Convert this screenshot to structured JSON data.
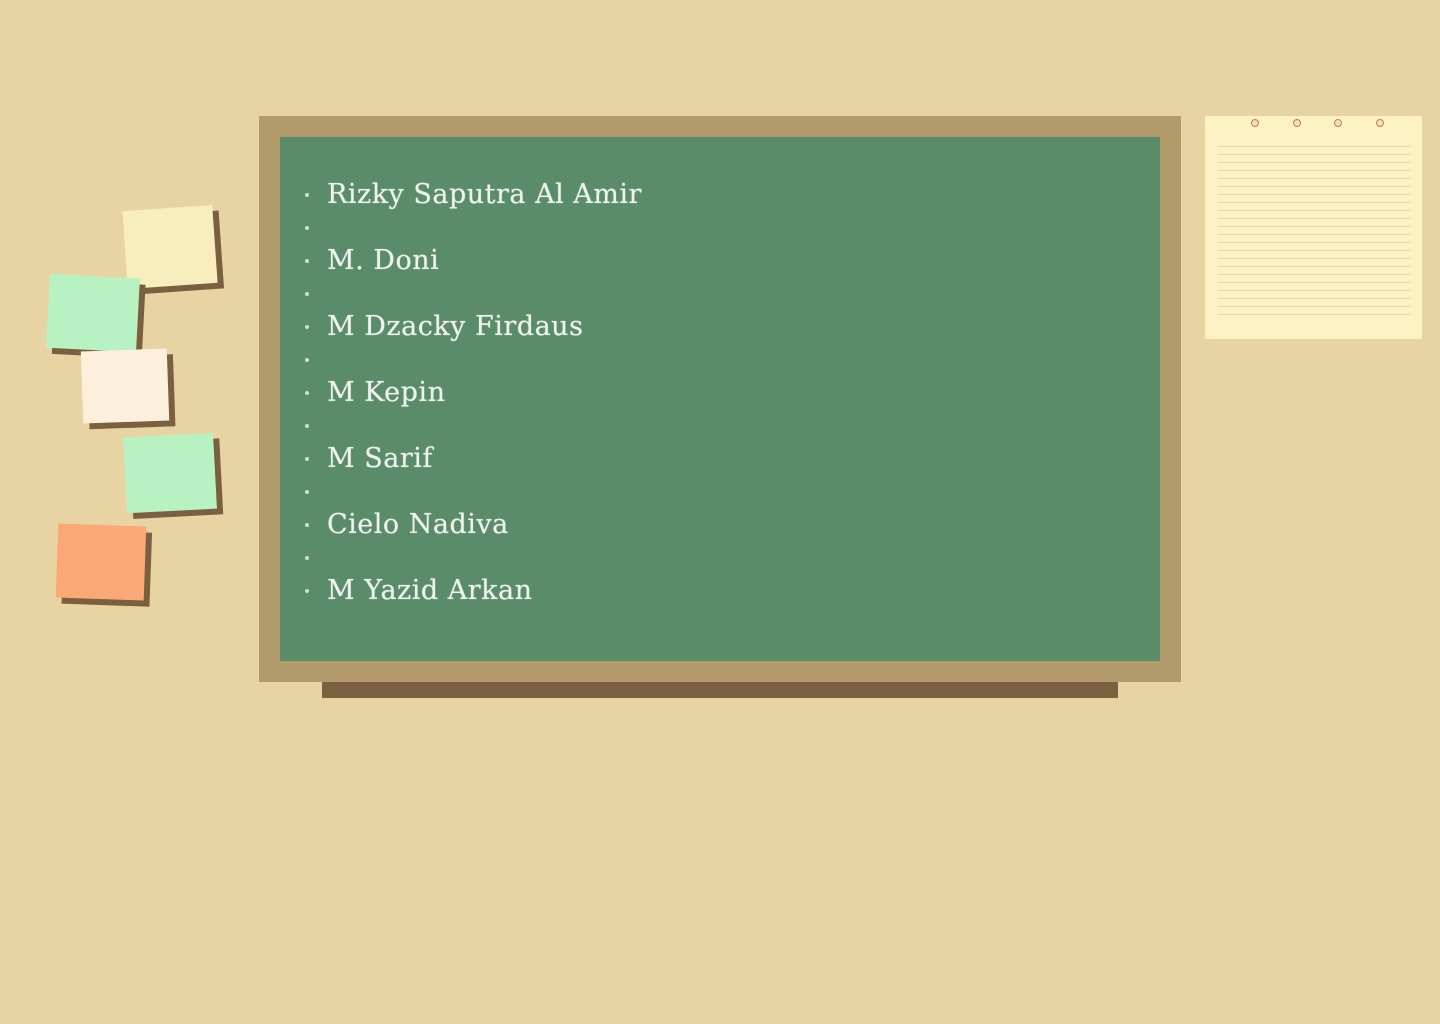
{
  "board": {
    "names": [
      "Rizky Saputra Al Amir",
      "",
      "M. Doni",
      "",
      "M Dzacky Firdaus",
      "",
      "M Kepin",
      "",
      "M Sarif",
      "",
      "Cielo Nadiva",
      "",
      "M Yazid Arkan"
    ]
  },
  "sticky_notes": [
    {
      "color": "#f8eebd"
    },
    {
      "color": "#b9f2c2"
    },
    {
      "color": "#fcf0dc"
    },
    {
      "color": "#b9f2c2"
    },
    {
      "color": "#fba877"
    }
  ],
  "notepad": {
    "color": "#fcf1c2"
  },
  "colors": {
    "background": "#e8d3a3",
    "board_frame": "#b39a6b",
    "board_surface": "#5b8c69",
    "chalk": "#eef3ee",
    "tray": "#7a6040"
  }
}
